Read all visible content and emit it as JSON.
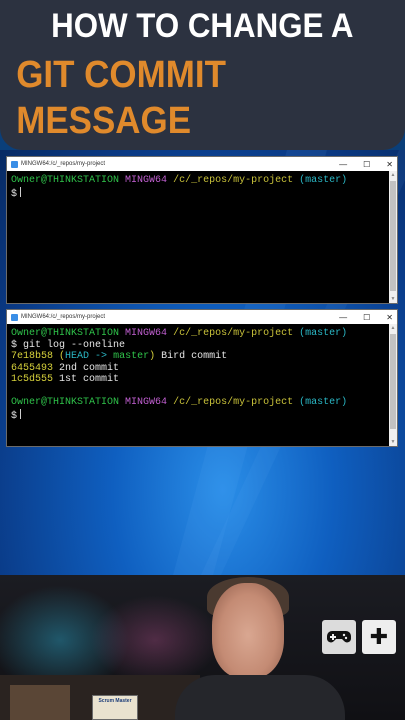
{
  "banner": {
    "line1": "HOW TO CHANGE A",
    "line2": "GIT COMMIT MESSAGE"
  },
  "window1": {
    "title": "MINGW64:/c/_repos/my-project",
    "prompt_user": "Owner@THINKSTATION",
    "prompt_shell": "MINGW64",
    "prompt_path": "/c/_repos/my-project",
    "prompt_branch": "(master)",
    "dollar": "$"
  },
  "window2": {
    "title": "MINGW64:/c/_repos/my-project",
    "prompt_user": "Owner@THINKSTATION",
    "prompt_shell": "MINGW64",
    "prompt_path": "/c/_repos/my-project",
    "prompt_branch": "(master)",
    "command": "$ git log --oneline",
    "commits": [
      {
        "hash": "7e18b58",
        "ref_open": "(",
        "head": "HEAD ->",
        "branch": "master",
        "ref_close": ")",
        "message": "Bird commit"
      },
      {
        "hash": "6455493",
        "message": "2nd commit"
      },
      {
        "hash": "1c5d555",
        "message": "1st commit"
      }
    ],
    "prompt2_user": "Owner@THINKSTATION",
    "prompt2_shell": "MINGW64",
    "prompt2_path": "/c/_repos/my-project",
    "prompt2_branch": "(master)",
    "dollar": "$"
  },
  "window_controls": {
    "minimize": "—",
    "maximize": "☐",
    "close": "✕"
  },
  "webcam": {
    "sign_text": "Scrum Master",
    "tile1_icon": "gamepad-icon",
    "tile2_icon": "plus-icon",
    "tile2_glyph": "✚"
  },
  "colors": {
    "banner_bg": "#2c3240",
    "title_orange": "#e08a2c",
    "prompt_green": "#2fc24a",
    "prompt_purple": "#c05fd0",
    "path_yellow": "#c9c23a",
    "branch_cyan": "#2ab7c5"
  }
}
